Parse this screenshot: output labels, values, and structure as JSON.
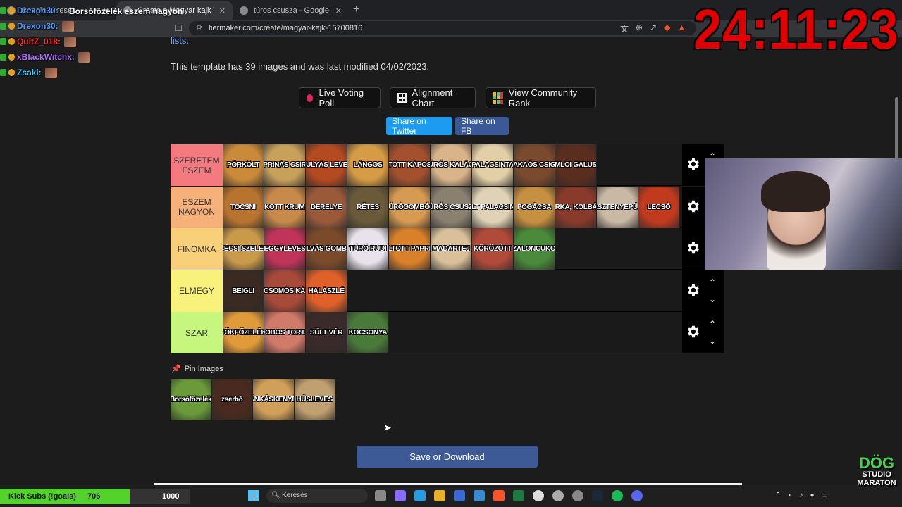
{
  "browser": {
    "tabs": [
      {
        "title": "Google-keresés",
        "active": false
      },
      {
        "title": "Create a Magyar kajk Tier List",
        "active": true
      },
      {
        "title": "túros csusza - Google-keresés",
        "active": false
      }
    ],
    "url": "tiermaker.com/create/magyar-kajk-15700816"
  },
  "stream": {
    "timer": "24:11:23",
    "title_overlay": "Borsófőzelék eszem nagyon",
    "chat": [
      {
        "user": "Drexon30:",
        "color": "#4a9bff"
      },
      {
        "user": "Drexon30:",
        "color": "#4a9bff"
      },
      {
        "user": "QuitZ_018:",
        "color": "#ff3030"
      },
      {
        "user": "xBlackWitchx:",
        "color": "#b070ff"
      },
      {
        "user": "Zsaki:",
        "color": "#3fd0ff"
      }
    ],
    "kick_goal": {
      "label": "Kick Subs (!goals)",
      "current": "706",
      "target": "1000",
      "progress": 0.706
    },
    "logo": {
      "line1": "DÖG",
      "line2": "STUDIO",
      "line3": "MARATON"
    }
  },
  "page": {
    "lists_link": "lists.",
    "template_info": "This template has 39 images and was last modified 04/02/2023.",
    "buttons": {
      "live_poll": "Live Voting Poll",
      "alignment": "Alignment Chart",
      "community": "View Community Rank",
      "twitter": "Share on Twitter",
      "fb": "Share on FB"
    },
    "tiers": [
      {
        "label": "SZERETEM ESZEM",
        "color": "#f47a80",
        "items": [
          {
            "name": "PÖRKÖLT",
            "bg": "#c98a3a"
          },
          {
            "name": "PRINÁS CSIR",
            "bg": "#c7a05a"
          },
          {
            "name": "GULYÁS LEVES",
            "bg": "#b44a22"
          },
          {
            "name": "LÁNGOS",
            "bg": "#d69b45"
          },
          {
            "name": "TÖLTÖTT KÁPOSZTA",
            "bg": "#a2502e"
          },
          {
            "name": "TÚRÓS KALÁCS",
            "bg": "#d9b48a"
          },
          {
            "name": "PALACSINTA",
            "bg": "#e3cfa7"
          },
          {
            "name": "KAKAÓS CSIGA",
            "bg": "#7a4a2e"
          },
          {
            "name": "SOMLÓI GALUSKA",
            "bg": "#5a2e1e"
          }
        ]
      },
      {
        "label": "ESZEM NAGYON",
        "color": "#f6b07a",
        "items": [
          {
            "name": "TOCSNI",
            "bg": "#b8742e"
          },
          {
            "name": "RAKOTT KRUMPLI",
            "bg": "#c78a4a"
          },
          {
            "name": "DERELYE",
            "bg": "#9a5a3a"
          },
          {
            "name": "RÉTES",
            "bg": "#6a5a3a"
          },
          {
            "name": "TÚRÓGOMBÓC",
            "bg": "#d69a52"
          },
          {
            "name": "TÚRÓS CSUSZA",
            "bg": "#8a8070"
          },
          {
            "name": "SÜLT PALACSINTA",
            "bg": "#e0d2b6"
          },
          {
            "name": "POGÁCSA",
            "bg": "#c69040"
          },
          {
            "name": "PÁRKA, KOLBÁSZ",
            "bg": "#8a3a2a"
          },
          {
            "name": "GESZTENYEPÜRÉ",
            "bg": "#c9b8a4"
          },
          {
            "name": "LECSÓ",
            "bg": "#c13a1e"
          }
        ]
      },
      {
        "label": "FINOMKA",
        "color": "#f8d07a",
        "items": [
          {
            "name": "BÉCSI SZELET",
            "bg": "#c99a4a"
          },
          {
            "name": "EGGYLEVES",
            "bg": "#c0345a"
          },
          {
            "name": "SZILVÁS GOMBÓC",
            "bg": "#7a4a2a"
          },
          {
            "name": "TÚRÓ RUDI",
            "bg": "#e8e2ea"
          },
          {
            "name": "TÖLTÖTT PAPRIKA",
            "bg": "#d8802a"
          },
          {
            "name": "MADÁRTEJ",
            "bg": "#d9c09a"
          },
          {
            "name": "KÖRÖZÖTT",
            "bg": "#b04a3a"
          },
          {
            "name": "SZALONCUKOR",
            "bg": "#4a8a3a"
          }
        ]
      },
      {
        "label": "ELMEGY",
        "color": "#f8f17c",
        "items": [
          {
            "name": "BEIGLI",
            "bg": "#3a2a22"
          },
          {
            "name": "ÁBRÁDICSOMÓS KÁPOSZTA",
            "bg": "#a84a3a"
          },
          {
            "name": "HALÁSZLÉ",
            "bg": "#e0602a"
          }
        ]
      },
      {
        "label": "SZAR",
        "color": "#c6f67e",
        "items": [
          {
            "name": "TÖKFŐZELÉK",
            "bg": "#e09a3a"
          },
          {
            "name": "DOBOS TORTA",
            "bg": "#d07a6a"
          },
          {
            "name": "SÜLT VÉR",
            "bg": "#3a2a2a"
          },
          {
            "name": "KOCSONYA",
            "bg": "#4a7a3a"
          }
        ]
      }
    ],
    "pin_title": "Pin Images",
    "pin_images": [
      {
        "name": "Borsófőzelék",
        "bg": "#6a9a3a"
      },
      {
        "name": "zserbó",
        "bg": "#4a2a1e"
      },
      {
        "name": "FÁNKÁSKENYÉR",
        "bg": "#d0a05a"
      },
      {
        "name": "HÚSLEVES",
        "bg": "#c0a070"
      }
    ],
    "save_label": "Save or Download"
  },
  "taskbar": {
    "search_placeholder": "Keresés"
  }
}
